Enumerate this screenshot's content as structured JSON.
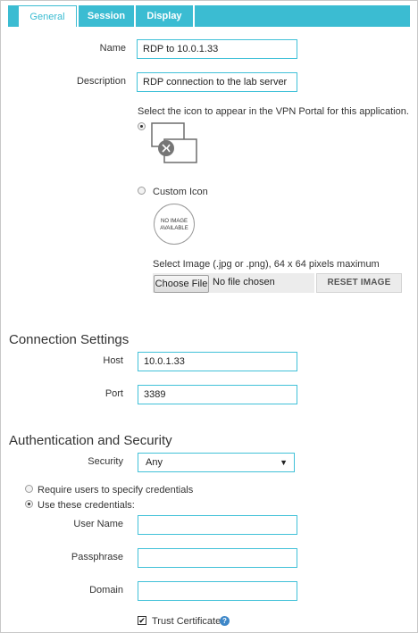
{
  "tabs": [
    "General",
    "Session",
    "Display"
  ],
  "general": {
    "name_label": "Name",
    "name_value": "RDP to 10.0.1.33",
    "description_label": "Description",
    "description_value": "RDP connection to the lab server",
    "icon_prompt": "Select the icon to appear in the VPN Portal for this application.",
    "custom_icon_label": "Custom Icon",
    "no_image_line1": "NO IMAGE",
    "no_image_line2": "AVAILABLE",
    "select_image_label": "Select Image (.jpg or .png), 64 x 64 pixels maximum",
    "choose_file_label": "Choose File",
    "no_file_text": "No file chosen",
    "reset_image_label": "RESET IMAGE"
  },
  "connection": {
    "title": "Connection Settings",
    "host_label": "Host",
    "host_value": "10.0.1.33",
    "port_label": "Port",
    "port_value": "3389"
  },
  "auth": {
    "title": "Authentication and Security",
    "security_label": "Security",
    "security_value": "Any",
    "require_label": "Require users to specify credentials",
    "use_label": "Use these credentials:",
    "username_label": "User Name",
    "username_value": "",
    "passphrase_label": "Passphrase",
    "passphrase_value": "",
    "domain_label": "Domain",
    "domain_value": "",
    "trust_label": "Trust Certificate",
    "trust_checked": true
  },
  "colors": {
    "accent": "#3bbcd2",
    "input_border": "#41c1d8",
    "help_icon": "#3e87c8"
  }
}
